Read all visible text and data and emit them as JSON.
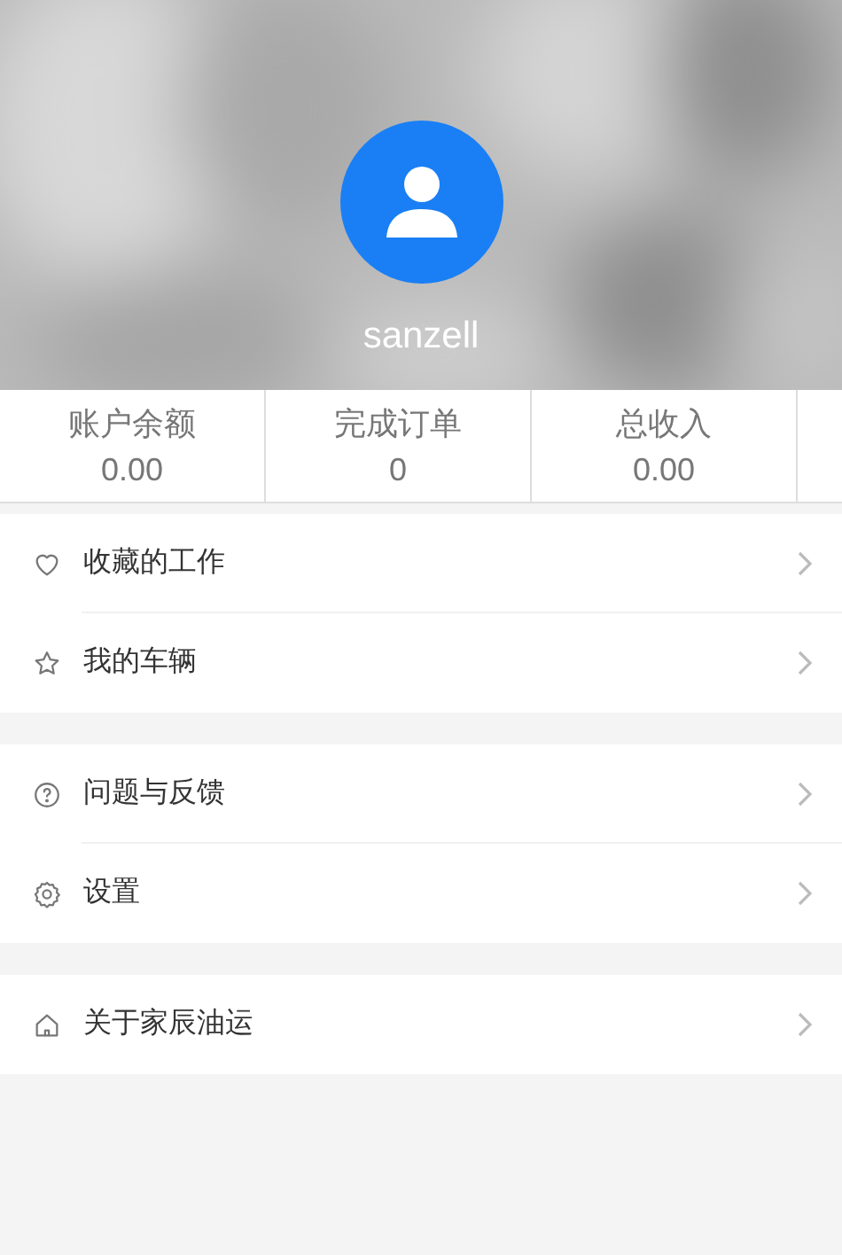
{
  "profile": {
    "username": "sanzell"
  },
  "stats": [
    {
      "label": "账户余额",
      "value": "0.00"
    },
    {
      "label": "完成订单",
      "value": "0"
    },
    {
      "label": "总收入",
      "value": "0.00"
    }
  ],
  "menu_groups": [
    {
      "items": [
        {
          "kind": "heart",
          "label": "收藏的工作"
        },
        {
          "kind": "star",
          "label": "我的车辆"
        }
      ]
    },
    {
      "items": [
        {
          "kind": "help",
          "label": "问题与反馈"
        },
        {
          "kind": "settings",
          "label": "设置"
        }
      ]
    },
    {
      "items": [
        {
          "kind": "home",
          "label": "关于家辰油运"
        }
      ]
    }
  ]
}
